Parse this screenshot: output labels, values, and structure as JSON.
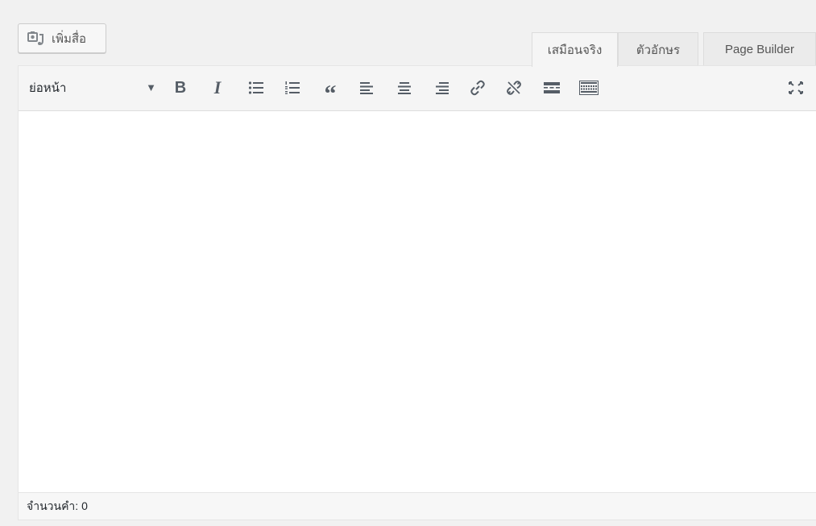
{
  "media": {
    "add_label": "เพิ่มสื่อ",
    "icon": "add-media-icon"
  },
  "tabs": [
    {
      "label": "เสมือนจริง",
      "active": true
    },
    {
      "label": "ตัวอักษร",
      "active": false
    },
    {
      "label": "Page Builder",
      "active": false
    }
  ],
  "toolbar": {
    "format": {
      "value": "ย่อหน้า"
    },
    "bold": "B",
    "italic": "I",
    "blockquote": "“",
    "buttons": [
      "bold",
      "italic",
      "bullet-list",
      "numbered-list",
      "blockquote",
      "align-left",
      "align-center",
      "align-right",
      "link",
      "unlink",
      "read-more",
      "toolbar-toggle",
      "fullscreen"
    ]
  },
  "editor": {
    "content": ""
  },
  "status": {
    "word_count_label": "จำนวนคำ: 0"
  },
  "colors": {
    "toolbar_bg": "#f5f5f5",
    "page_bg": "#f1f1f1",
    "icon": "#555d66"
  }
}
